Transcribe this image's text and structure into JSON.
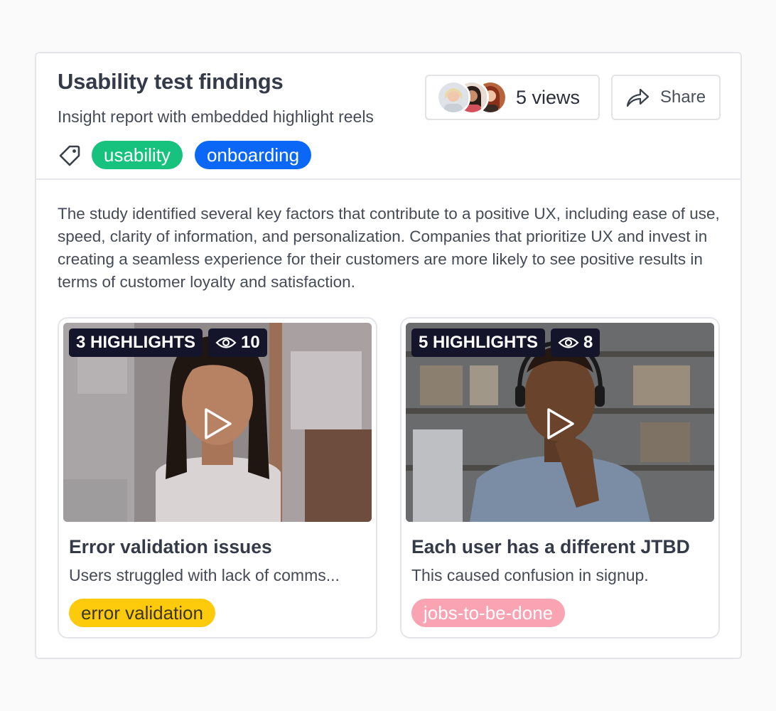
{
  "report": {
    "title": "Usability test findings",
    "subtitle": "Insight report with embedded highlight reels",
    "tag_icon": "tag-icon",
    "tags": [
      {
        "label": "usability",
        "color": "#17c27e"
      },
      {
        "label": "onboarding",
        "color": "#0b67f5"
      }
    ],
    "views_label": "5 views",
    "share_label": "Share",
    "share_icon": "share-arrow-icon",
    "body": "The study identified several key factors that contribute to a positive UX, including ease of use, speed, clarity of information, and personalization. Companies that prioritize UX and invest in creating a seamless experience for their customers are more likely to see positive results in terms of customer loyalty and satisfaction."
  },
  "reels": [
    {
      "highlights": "3 HIGHLIGHTS",
      "views": "10",
      "title": "Error validation issues",
      "description": "Users struggled with lack of comms...",
      "tag": {
        "label": "error validation",
        "color": "#fdca0c"
      }
    },
    {
      "highlights": "5 HIGHLIGHTS",
      "views": "8",
      "title": "Each user has a different JTBD",
      "description": "This caused confusion in signup.",
      "tag": {
        "label": "jobs-to-be-done",
        "color": "#f9a3b3"
      }
    }
  ]
}
